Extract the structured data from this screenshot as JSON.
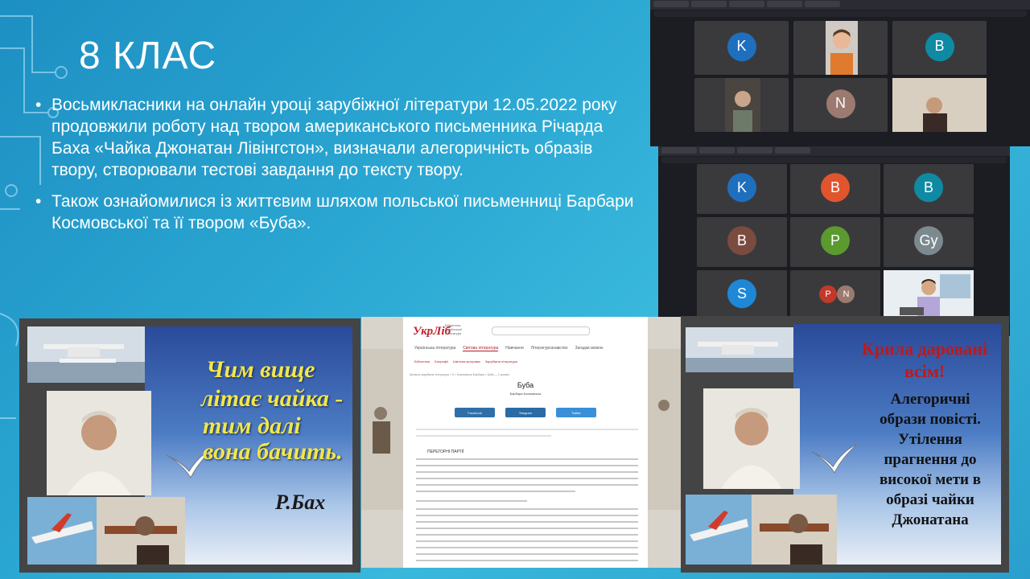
{
  "slide": {
    "title": "8 КЛАС",
    "bullets": [
      "Восьмикласники на онлайн уроці зарубіжної літератури 12.05.2022 року продовжили роботу над  твором американського письменника Річарда Баха «Чайка Джонатан Лівінгстон», визначали алегоричність образів твору, створювали тестові завдання до тексту твору.",
      "Також ознайомилися із життєвим шляхом польської письменниці Барбари Космовської та її твором  «Буба»."
    ],
    "bullet_symbol": "•"
  },
  "zoom_top": {
    "tiles": [
      {
        "initial": "K",
        "color": "#1f6fbf"
      },
      {
        "initial": "",
        "color": ""
      },
      {
        "initial": "B",
        "color": "#0f8aa3"
      },
      {
        "initial": "",
        "color": ""
      },
      {
        "initial": "N",
        "color": "#9c7a70"
      },
      {
        "initial": "",
        "color": ""
      }
    ]
  },
  "zoom_bottom": {
    "tiles": [
      {
        "initial": "K",
        "color": "#1f6fbf"
      },
      {
        "initial": "B",
        "color": "#e0552d"
      },
      {
        "initial": "B",
        "color": "#0f8aa3"
      },
      {
        "initial": "B",
        "color": "#7b4b40"
      },
      {
        "initial": "P",
        "color": "#5a9a2e"
      },
      {
        "initial": "Gy",
        "color": "#7c8a8f"
      },
      {
        "initial": "S",
        "color": "#1e88d6"
      },
      {
        "initial_1": "P",
        "color_1": "#c0392b",
        "initial_2": "N",
        "color_2": "#9c7a70"
      },
      {
        "initial": "",
        "color": ""
      }
    ]
  },
  "left_panel": {
    "quote_lines": [
      "Чим  вище",
      "літає чайка -",
      "тим далі",
      "вона бачить."
    ],
    "author": "Р.Бах"
  },
  "right_panel": {
    "red_lines": [
      "Крила даровані",
      "всім!"
    ],
    "black_lines": [
      "Алегоричні",
      "образи повісті.",
      "Утілення",
      "прагнення до",
      "високої мети в",
      "образі чайки",
      "Джонатана"
    ]
  },
  "website": {
    "logo": "УкрЛіб",
    "logo_sub": "Бібліотека Української Літератури",
    "nav": [
      "Українська література",
      "Світова література",
      "Навчання",
      "Літературознавство",
      "Загадки мовою"
    ],
    "active_nav": "Світова література",
    "sub_nav": [
      "Бібліотека",
      "Біографії",
      "Шкільна програма",
      "Зарубіжна література"
    ],
    "breadcrumb": "Шкільна зарубіжна література  >  8  >  Космовська Барбара  >  Буба — 2 уривок",
    "title": "Буба",
    "author": "Барбара Космовська",
    "share": [
      {
        "label": "Facebook",
        "color": "#2f6fa8"
      },
      {
        "label": "Telegram",
        "color": "#2a6aa5"
      },
      {
        "label": "Twitter",
        "color": "#3a8fd8"
      }
    ],
    "chapter": "ПЕРЕГОРНІ ПАРТІЇ"
  },
  "colors": {
    "background": "#2aa6d2",
    "title_text": "#ffffff",
    "quote": "#f2e64a",
    "red_heading": "#c01818",
    "brand_red": "#c0202e"
  }
}
